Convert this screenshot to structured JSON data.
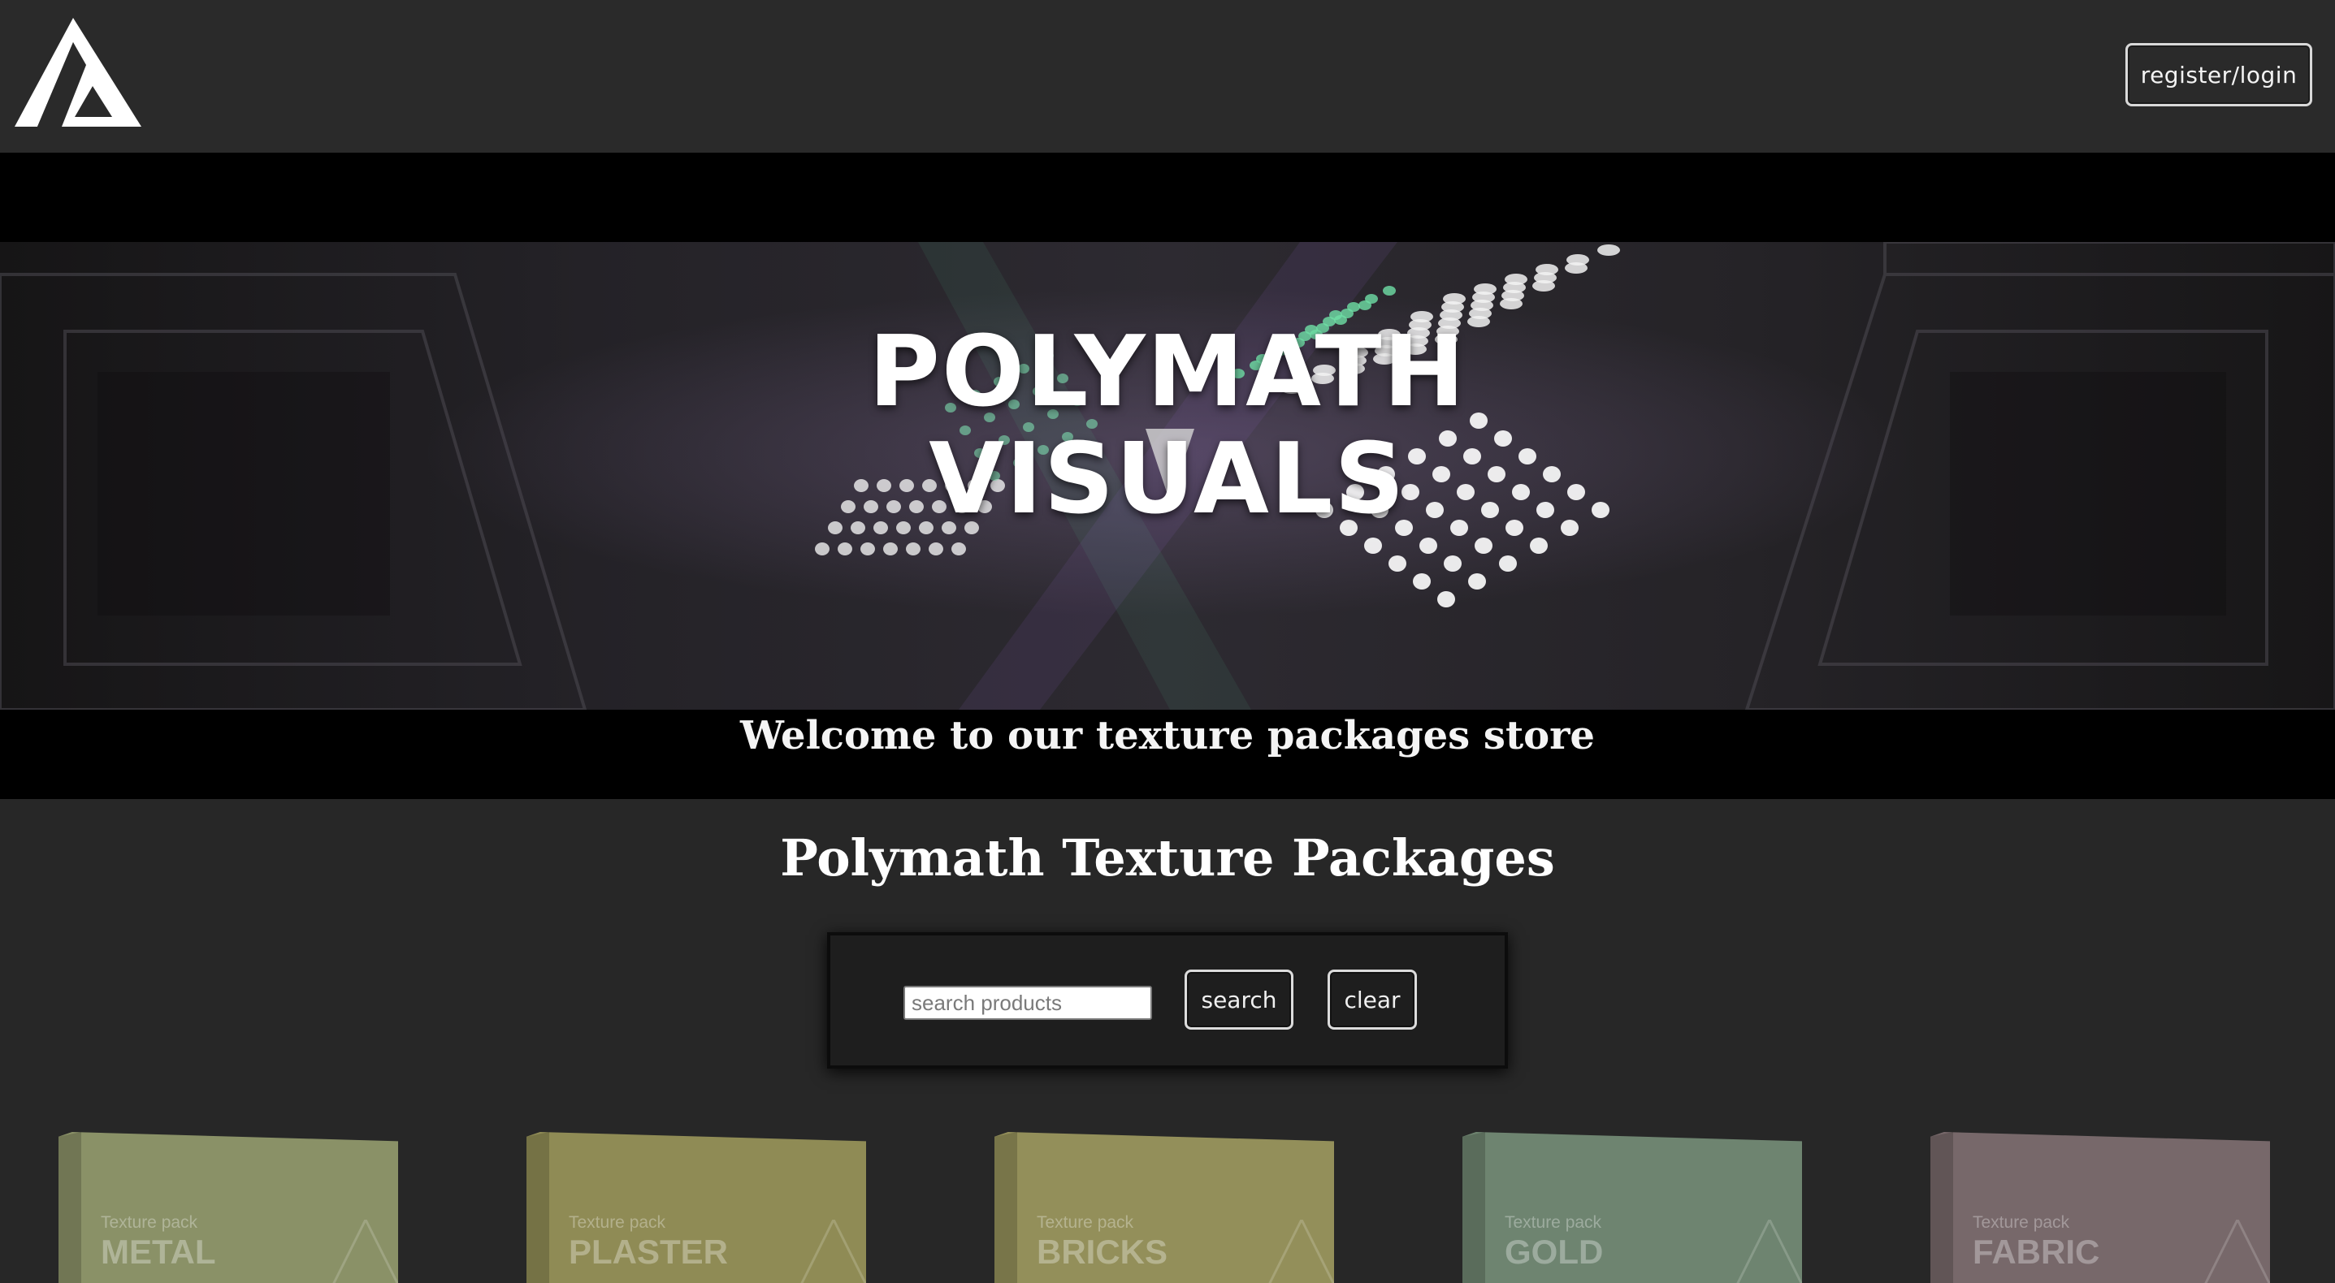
{
  "header": {
    "logo_icon": "polymath-triangle-logo-icon",
    "login_label": "register/login"
  },
  "hero": {
    "title_line1": "POLYMATH",
    "title_line2": "VISUALS",
    "subtitle": "Welcome to our texture packages store"
  },
  "section": {
    "title": "Polymath Texture Packages"
  },
  "search": {
    "placeholder": "search products",
    "value": "",
    "search_label": "search",
    "clear_label": "clear"
  },
  "products": [
    {
      "tag": "Texture pack",
      "name": "METAL",
      "color": "#8a9167"
    },
    {
      "tag": "Texture pack",
      "name": "PLASTER",
      "color": "#8f8b55"
    },
    {
      "tag": "Texture pack",
      "name": "BRICKS",
      "color": "#938f5a"
    },
    {
      "tag": "Texture pack",
      "name": "GOLD",
      "color": "#6e8470"
    },
    {
      "tag": "Texture pack",
      "name": "FABRIC",
      "color": "#77686a"
    }
  ],
  "colors": {
    "page_background": "#272727",
    "hero_background": "#000000",
    "accent_green": "#5fd39a",
    "accent_purple": "#9b6bd6"
  }
}
